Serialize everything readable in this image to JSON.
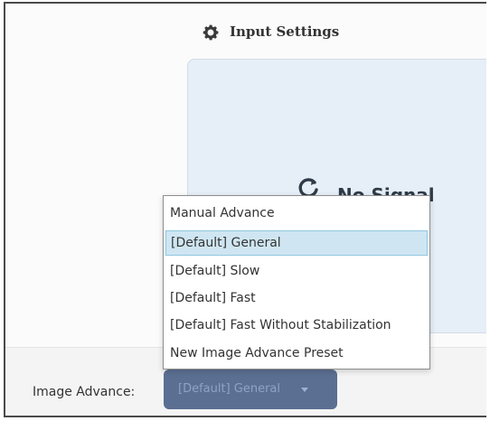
{
  "header": {
    "title": "Input Settings",
    "icon": "gear-icon"
  },
  "preview": {
    "status_text": "No Signal",
    "icon": "refresh-icon"
  },
  "image_advance": {
    "label": "Image Advance:",
    "selected_value": "[Default] General"
  },
  "dropdown": {
    "options": [
      {
        "label": "Manual Advance",
        "selected": false
      },
      {
        "label": "[Default] General",
        "selected": true
      },
      {
        "label": "[Default] Slow",
        "selected": false
      },
      {
        "label": "[Default] Fast",
        "selected": false
      },
      {
        "label": "[Default] Fast Without Stabilization",
        "selected": false
      },
      {
        "label": "New Image Advance Preset",
        "selected": false
      }
    ]
  },
  "colors": {
    "selected_highlight": "#cfe6f2",
    "button_bg": "#5b6f92",
    "preview_bg": "#e6eef7"
  }
}
